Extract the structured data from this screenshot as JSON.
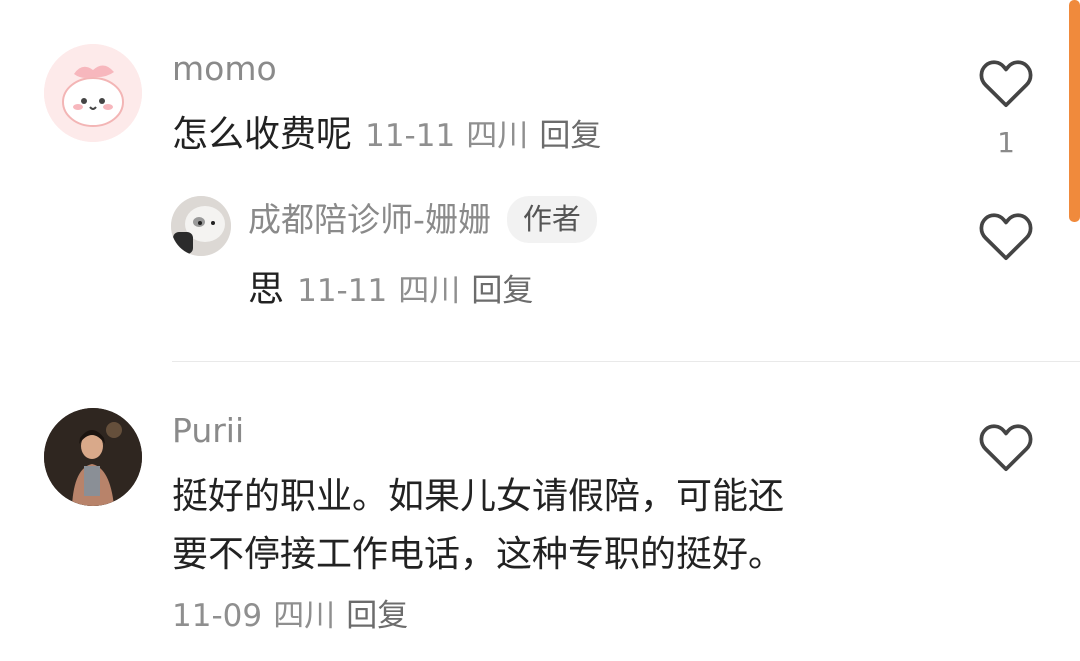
{
  "comments": [
    {
      "username": "momo",
      "text": "怎么收费呢",
      "date": "11-11",
      "location": "四川",
      "reply_label": "回复",
      "like_count": "1",
      "replies": [
        {
          "username": "成都陪诊师-姗姗",
          "badge": "作者",
          "text": "思",
          "date": "11-11",
          "location": "四川",
          "reply_label": "回复"
        }
      ]
    },
    {
      "username": "Purii",
      "text_lines": [
        "挺好的职业。如果儿女请假陪，可能还",
        "要不停接工作电话，这种专职的挺好。"
      ],
      "date": "11-09",
      "location": "四川",
      "reply_label": "回复"
    }
  ],
  "icons": {
    "like": "heart-outline-icon"
  },
  "colors": {
    "accent_scroll": "#f08a3c",
    "username": "#8a8a8a",
    "text": "#222222",
    "meta": "#8f8f8f"
  }
}
